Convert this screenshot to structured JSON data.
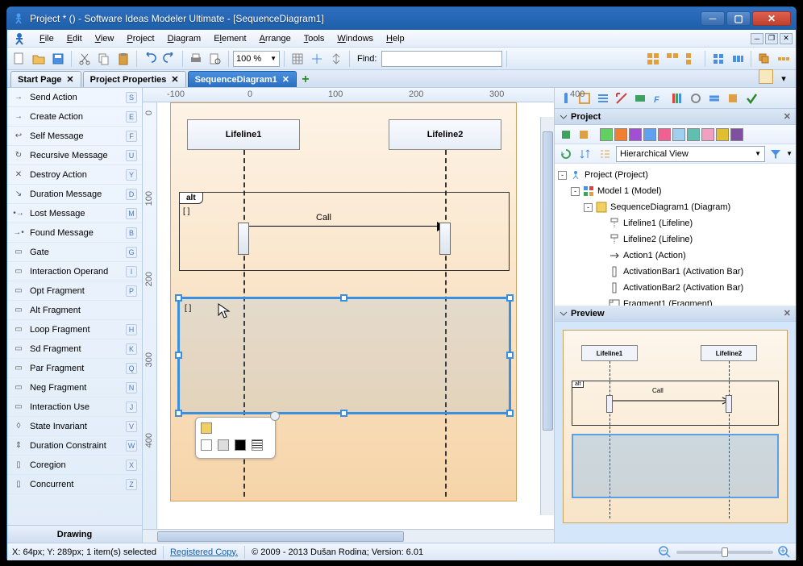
{
  "window": {
    "title": "Project *  ()  - Software Ideas Modeler Ultimate - [SequenceDiagram1]"
  },
  "menu": {
    "file": "File",
    "edit": "Edit",
    "view": "View",
    "project": "Project",
    "diagram": "Diagram",
    "element": "Element",
    "arrange": "Arrange",
    "tools": "Tools",
    "windows": "Windows",
    "help": "Help"
  },
  "toolbar": {
    "zoom": "100 %",
    "findLabel": "Find:",
    "findValue": ""
  },
  "tabs": {
    "startPage": "Start Page",
    "projectProps": "Project Properties",
    "seqDiag": "SequenceDiagram1"
  },
  "toolbox": {
    "items": [
      {
        "label": "Send Action",
        "key": "S",
        "icon": "→"
      },
      {
        "label": "Create Action",
        "key": "E",
        "icon": "→"
      },
      {
        "label": "Self Message",
        "key": "F",
        "icon": "↩"
      },
      {
        "label": "Recursive Message",
        "key": "U",
        "icon": "↻"
      },
      {
        "label": "Destroy Action",
        "key": "Y",
        "icon": "✕"
      },
      {
        "label": "Duration Message",
        "key": "D",
        "icon": "↘"
      },
      {
        "label": "Lost Message",
        "key": "M",
        "icon": "•→"
      },
      {
        "label": "Found Message",
        "key": "B",
        "icon": "→•"
      },
      {
        "label": "Gate",
        "key": "G",
        "icon": "▭"
      },
      {
        "label": "Interaction Operand",
        "key": "I",
        "icon": "▭"
      },
      {
        "label": "Opt Fragment",
        "key": "P",
        "icon": "▭"
      },
      {
        "label": "Alt Fragment",
        "key": "",
        "icon": "▭"
      },
      {
        "label": "Loop Fragment",
        "key": "H",
        "icon": "▭"
      },
      {
        "label": "Sd Fragment",
        "key": "K",
        "icon": "▭"
      },
      {
        "label": "Par Fragment",
        "key": "Q",
        "icon": "▭"
      },
      {
        "label": "Neg Fragment",
        "key": "N",
        "icon": "▭"
      },
      {
        "label": "Interaction Use",
        "key": "J",
        "icon": "▭"
      },
      {
        "label": "State Invariant",
        "key": "V",
        "icon": "◊"
      },
      {
        "label": "Duration Constraint",
        "key": "W",
        "icon": "⇕"
      },
      {
        "label": "Coregion",
        "key": "X",
        "icon": "▯"
      },
      {
        "label": "Concurrent",
        "key": "Z",
        "icon": "▯"
      }
    ],
    "footer": "Drawing"
  },
  "ruler": {
    "h": [
      "-100",
      "0",
      "100",
      "200",
      "300",
      "400"
    ],
    "v": [
      "0",
      "100",
      "200",
      "300",
      "400"
    ]
  },
  "diagram": {
    "lifeline1": "Lifeline1",
    "lifeline2": "Lifeline2",
    "alt": "alt",
    "bracket": "[ ]",
    "call": "Call",
    "selBracket": "[ ]"
  },
  "project": {
    "header": "Project",
    "viewMode": "Hierarchical View",
    "tree": [
      {
        "indent": 0,
        "exp": "-",
        "icon": "proj",
        "label": "Project (Project)"
      },
      {
        "indent": 1,
        "exp": "-",
        "icon": "model",
        "label": "Model 1 (Model)"
      },
      {
        "indent": 2,
        "exp": "-",
        "icon": "diag",
        "label": "SequenceDiagram1 (Diagram)"
      },
      {
        "indent": 3,
        "exp": "",
        "icon": "life",
        "label": "Lifeline1 (Lifeline)"
      },
      {
        "indent": 3,
        "exp": "",
        "icon": "life",
        "label": "Lifeline2 (Lifeline)"
      },
      {
        "indent": 3,
        "exp": "",
        "icon": "act",
        "label": "Action1 (Action)"
      },
      {
        "indent": 3,
        "exp": "",
        "icon": "bar",
        "label": "ActivationBar1 (Activation Bar)"
      },
      {
        "indent": 3,
        "exp": "",
        "icon": "bar",
        "label": "ActivationBar2 (Activation Bar)"
      },
      {
        "indent": 3,
        "exp": "",
        "icon": "frag",
        "label": "Fragment1 (Fragment)"
      }
    ]
  },
  "preview": {
    "header": "Preview",
    "life1": "Lifeline1",
    "life2": "Lifeline2",
    "alt": "alt",
    "call": "Call"
  },
  "status": {
    "coords": "X: 64px; Y: 289px; 1 item(s) selected",
    "reg": "Registered Copy.",
    "copy": "© 2009 - 2013 Dušan Rodina; Version: 6.01"
  },
  "colors": {
    "accent": "#3a8fe0",
    "titlebar": "#1e5faa"
  }
}
